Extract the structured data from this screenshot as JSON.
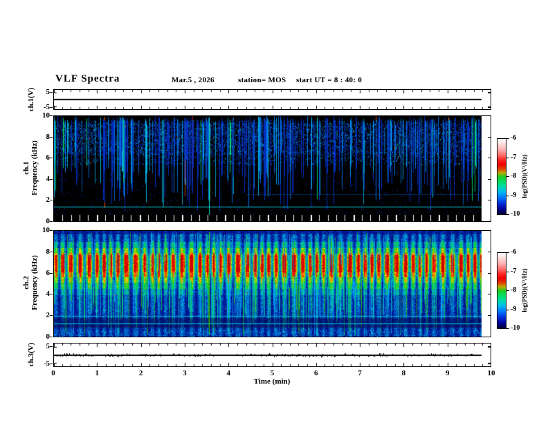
{
  "header": {
    "title": "VLF Spectra",
    "date": "Mar.5 , 2026",
    "station": "station= MOS",
    "start_ut": "start UT =  8 : 40: 0"
  },
  "axes": {
    "time_label": "Time (min)",
    "time_ticks": [
      0,
      1,
      2,
      3,
      4,
      5,
      6,
      7,
      8,
      9,
      10
    ],
    "freq_ticks": [
      10,
      8,
      6,
      4,
      2,
      0
    ],
    "volt_ticks": [
      5,
      -5
    ],
    "colorbar_ticks": [
      -6,
      -7,
      -8,
      -9,
      -10
    ],
    "colorbar_label": "log(PSD)(V²/Hz)"
  },
  "panels": {
    "ch1_volts": {
      "label": "ch.1(V)"
    },
    "ch1_spec": {
      "label_line1": "ch.1",
      "label_line2": "Frequency (kHz)"
    },
    "ch2_spec": {
      "label_line1": "ch.2",
      "label_line2": "Frequency (kHz)"
    },
    "ch3_volts": {
      "label": "ch.3(V)"
    }
  },
  "chart_data": [
    {
      "id": "ch1-voltage",
      "type": "line",
      "title": "ch.1 raw signal (V)",
      "xlabel": "Time (min)",
      "xlim": [
        0,
        10
      ],
      "data_end_min": 9.79,
      "ylim": [
        -7,
        7
      ],
      "yticks": [
        5,
        -5
      ],
      "series": [
        {
          "name": "ch.1 (V)",
          "description": "flat trace at 0 V for full record",
          "baseline_v": 0,
          "noise_amp_v": 0.0
        }
      ],
      "render": {
        "seed": 11,
        "thickness_px": 2
      }
    },
    {
      "id": "ch1-spectrogram",
      "type": "heatmap",
      "title": "ch.1 VLF spectrogram",
      "xlabel": "Time (min)",
      "xlim": [
        0,
        10
      ],
      "data_end_min": 9.79,
      "ylabel": "Frequency (kHz)",
      "ylim": [
        0,
        10
      ],
      "yticks": [
        10,
        8,
        6,
        4,
        2,
        0
      ],
      "zlabel": "log(PSD)(V²/Hz)",
      "zlim": [
        -10,
        -6
      ],
      "background_level": -10,
      "content": {
        "description": "black background (≤ -10) with dense blue/cyan impulsive vertical streaks; diffuse blue speckle band 5.2–9.6 kHz; narrow cyan horizontal carrier at 0.85 kHz; bright full-height line near t = 3.55 min; occasional red specks",
        "speckle_band_khz": [
          5.2,
          9.6
        ],
        "streaks_from_khz": [
          8.5,
          10
        ],
        "streaks_to_khz": [
          0.3,
          5
        ],
        "horizontal_line_khz": 0.85,
        "full_height_line_min": 3.55
      },
      "render": {
        "seed": 1234,
        "streak_count": 230,
        "short_streak_count": 60,
        "speckles_per_col": 34,
        "red_speck_count": 14
      }
    },
    {
      "id": "ch2-spectrogram",
      "type": "heatmap",
      "title": "ch.2 VLF spectrogram",
      "xlabel": "Time (min)",
      "xlim": [
        0,
        10
      ],
      "data_end_min": 9.79,
      "ylabel": "Frequency (kHz)",
      "ylim": [
        0,
        10
      ],
      "yticks": [
        10,
        8,
        6,
        4,
        2,
        0
      ],
      "zlabel": "log(PSD)(V²/Hz)",
      "zlim": [
        -10,
        -6
      ],
      "background_level": -9.3,
      "content": {
        "description": "blue background with intense burst-modulated emission band; red cores 6.1–7.7 kHz fringed by yellow/green 5–8.6 kHz; green/cyan streaks down to 0 kHz and up to 10 kHz; cyan horizontal carriers at 1.2 and 1.9 kHz; bright full-height line near t = 3.55 min",
        "core_band_khz": [
          6.1,
          7.7
        ],
        "main_band_khz": [
          5.0,
          8.6
        ],
        "horizontal_lines_khz": [
          1.2,
          1.9
        ],
        "full_height_line_min": 3.55,
        "burst_period_min": 0.18
      },
      "render": {
        "seed": 777,
        "lower_streak_count": 240,
        "top_streak_count": 130,
        "red_speck_count": 12
      }
    },
    {
      "id": "ch3-voltage",
      "type": "line",
      "title": "ch.3 raw signal (V)",
      "xlabel": "Time (min)",
      "xlim": [
        0,
        10
      ],
      "data_end_min": 9.79,
      "ylim": [
        -7,
        7
      ],
      "yticks": [
        5,
        -5
      ],
      "series": [
        {
          "name": "ch.3 (V)",
          "description": "near-flat trace at 0 V with low-amplitude noise ripple",
          "baseline_v": 0,
          "noise_amp_v": 0.4
        }
      ],
      "render": {
        "seed": 42,
        "thickness_px": 2
      }
    },
    {
      "id": "colorbar",
      "type": "table",
      "title": "power spectral density colour scale",
      "label": "log(PSD)(V²/Hz)",
      "ticks": [
        -6,
        -7,
        -8,
        -9,
        -10
      ],
      "stops": [
        [
          0.0,
          "#ffffff"
        ],
        [
          0.06,
          "#ffe2e2"
        ],
        [
          0.14,
          "#ffb2b2"
        ],
        [
          0.22,
          "#ff6a6a"
        ],
        [
          0.28,
          "#ff2222"
        ],
        [
          0.34,
          "#ee0000"
        ],
        [
          0.4,
          "#dd4400"
        ],
        [
          0.45,
          "#bbaa00"
        ],
        [
          0.5,
          "#22cc22"
        ],
        [
          0.57,
          "#00dd66"
        ],
        [
          0.63,
          "#00ddaa"
        ],
        [
          0.7,
          "#00bbee"
        ],
        [
          0.78,
          "#0077ff"
        ],
        [
          0.85,
          "#0033dd"
        ],
        [
          0.93,
          "#000099"
        ],
        [
          1.0,
          "#000033"
        ]
      ]
    }
  ]
}
